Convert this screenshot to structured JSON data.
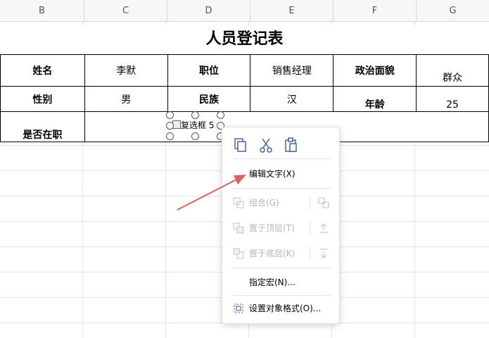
{
  "columns": [
    "B",
    "C",
    "D",
    "E",
    "F",
    "G"
  ],
  "sheet": {
    "title": "人员登记表",
    "rows": [
      [
        "姓名",
        "李默",
        "职位",
        "销售经理",
        "政治面貌",
        "群众"
      ],
      [
        "性别",
        "男",
        "民族",
        "汉",
        "年龄",
        "25"
      ],
      [
        "是否在职"
      ]
    ]
  },
  "checkbox": {
    "label": "复选框 5"
  },
  "menu": {
    "edit_text": "编辑文字(X)",
    "group": "组合(G)",
    "bring_to_front": "置于顶层(T)",
    "send_to_back": "置于底层(K)",
    "assign_macro": "指定宏(N)...",
    "format_object": "设置对象格式(O)..."
  },
  "colors": {
    "arrow": "#e0605e",
    "grid": "#e3e3e3"
  }
}
